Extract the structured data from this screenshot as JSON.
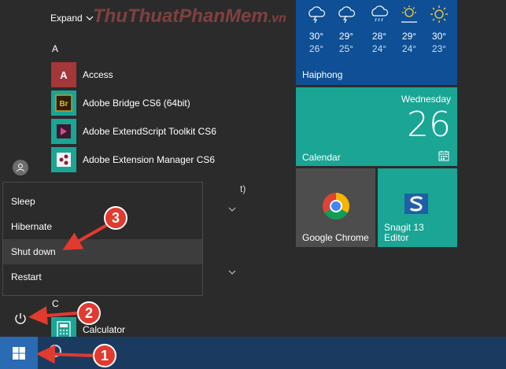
{
  "watermark": {
    "main": "ThuThuatPhanMem",
    "suffix": ".vn"
  },
  "applist": {
    "expand_label": "Expand",
    "sections": [
      {
        "letter": "A"
      },
      {
        "letter": "C"
      }
    ],
    "apps": [
      {
        "label": "Access",
        "icon": "access-icon"
      },
      {
        "label": "Adobe Bridge CS6 (64bit)",
        "icon": "bridge-icon"
      },
      {
        "label": "Adobe ExtendScript Toolkit CS6",
        "icon": "extendscript-icon"
      },
      {
        "label": "Adobe Extension Manager CS6",
        "icon": "extension-manager-icon"
      },
      {
        "label": "Calculator",
        "icon": "calculator-icon"
      }
    ],
    "partial_text": "t)"
  },
  "power_menu": {
    "items": [
      {
        "label": "Sleep"
      },
      {
        "label": "Hibernate"
      },
      {
        "label": "Shut down"
      },
      {
        "label": "Restart"
      }
    ],
    "hovered": "Shut down"
  },
  "weather": {
    "city": "Haiphong",
    "days": [
      {
        "icon": "thunderstorm-icon",
        "high": "30°",
        "low": "26°"
      },
      {
        "icon": "thunderstorm-icon",
        "high": "29°",
        "low": "25°"
      },
      {
        "icon": "rain-icon",
        "high": "28°",
        "low": "24°"
      },
      {
        "icon": "partly-sunny-icon",
        "high": "29°",
        "low": "24°"
      },
      {
        "icon": "sunny-icon",
        "high": "30°",
        "low": "23°"
      }
    ]
  },
  "calendar": {
    "weekday": "Wednesday",
    "date": "26",
    "label": "Calendar"
  },
  "tiles": {
    "chrome": "Google Chrome",
    "snagit_line1": "Snagit 13",
    "snagit_line2": "Editor"
  },
  "annotations": [
    "1",
    "2",
    "3"
  ],
  "colors": {
    "accent": "#1aa595",
    "weather_tile": "#0e4f95",
    "annotation_red": "#e23a2f",
    "taskbar": "#1b3a60"
  }
}
